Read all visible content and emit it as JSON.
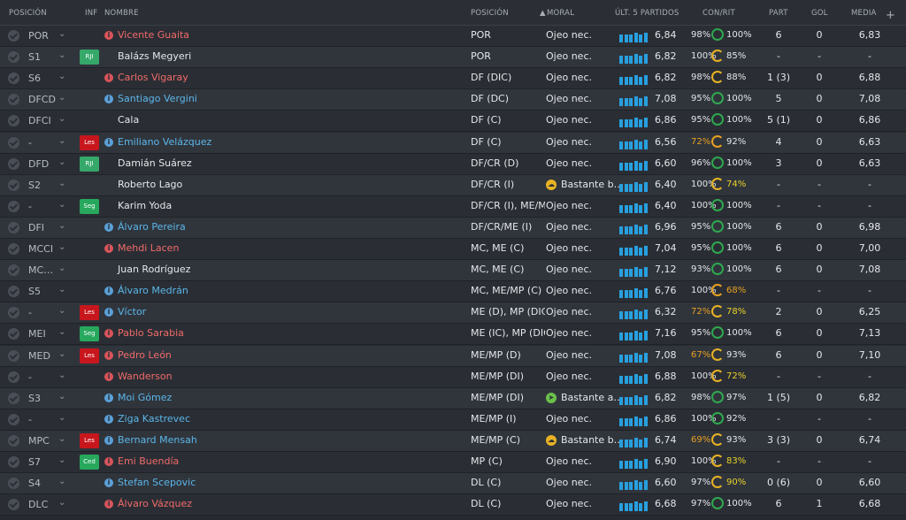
{
  "header": {
    "posicion": "POSICIÓN",
    "inf": "INF",
    "nombre": "NOMBRE",
    "posicion2": "POSICIÓN",
    "moral": "MORAL",
    "ult5": "ÚLT. 5 PARTIDOS",
    "conrit": "CON/RIT",
    "part": "PART",
    "gol": "GOL",
    "media": "MEDIA",
    "plus": "+"
  },
  "players": [
    {
      "pos": "POR",
      "badge": "",
      "info": "red",
      "name": "Vicente Guaita",
      "nameColor": "red",
      "cpos": "POR",
      "moral": "Ojeo nec.",
      "micon": "",
      "rating": "6,84",
      "con": "98%",
      "ring": "g",
      "rit": "100%",
      "part": "6",
      "gol": "0",
      "media": "6,83"
    },
    {
      "pos": "S1",
      "badge": "RJI",
      "info": "",
      "name": "Balázs Megyeri",
      "nameColor": "white",
      "cpos": "POR",
      "moral": "Ojeo nec.",
      "micon": "",
      "rating": "6,82",
      "con": "100%",
      "ring": "y",
      "rit": "85%",
      "part": "-",
      "gol": "-",
      "media": "-"
    },
    {
      "pos": "S6",
      "badge": "",
      "info": "red",
      "name": "Carlos Vigaray",
      "nameColor": "red",
      "cpos": "DF (DIC)",
      "moral": "Ojeo nec.",
      "micon": "",
      "rating": "6,82",
      "con": "98%",
      "ring": "y",
      "rit": "88%",
      "part": "1 (3)",
      "gol": "0",
      "media": "6,88"
    },
    {
      "pos": "DFCD",
      "badge": "",
      "info": "blue",
      "name": "Santiago Vergini",
      "nameColor": "blue",
      "cpos": "DF (DC)",
      "moral": "Ojeo nec.",
      "micon": "",
      "rating": "7,08",
      "con": "95%",
      "ring": "g",
      "rit": "100%",
      "part": "5",
      "gol": "0",
      "media": "7,08"
    },
    {
      "pos": "DFCI",
      "badge": "",
      "info": "",
      "name": "Cala",
      "nameColor": "white",
      "cpos": "DF (C)",
      "moral": "Ojeo nec.",
      "micon": "",
      "rating": "6,86",
      "con": "95%",
      "ring": "g",
      "rit": "100%",
      "part": "5 (1)",
      "gol": "0",
      "media": "6,86"
    },
    {
      "pos": "-",
      "badge": "Les",
      "info": "blue",
      "name": "Emiliano Velázquez",
      "nameColor": "blue",
      "cpos": "DF (C)",
      "moral": "Ojeo nec.",
      "micon": "",
      "rating": "6,56",
      "con": "72%",
      "conColor": "o",
      "ring": "o",
      "rit": "92%",
      "part": "4",
      "gol": "0",
      "media": "6,63"
    },
    {
      "pos": "DFD",
      "badge": "RJI",
      "info": "",
      "name": "Damián Suárez",
      "nameColor": "white",
      "cpos": "DF/CR (D)",
      "moral": "Ojeo nec.",
      "micon": "",
      "rating": "6,60",
      "con": "96%",
      "ring": "g",
      "rit": "100%",
      "part": "3",
      "gol": "0",
      "media": "6,63"
    },
    {
      "pos": "S2",
      "badge": "",
      "info": "",
      "name": "Roberto Lago",
      "nameColor": "white",
      "cpos": "DF/CR (I)",
      "moral": "Bastante b…",
      "micon": "y",
      "rating": "6,40",
      "con": "100%",
      "ring": "y",
      "rit": "74%",
      "ritColor": "y",
      "part": "-",
      "gol": "-",
      "media": "-"
    },
    {
      "pos": "-",
      "badge": "Seg",
      "info": "",
      "name": "Karim Yoda",
      "nameColor": "white",
      "cpos": "DF/CR (I), ME/M…",
      "moral": "Ojeo nec.",
      "micon": "",
      "rating": "6,40",
      "con": "100%",
      "ring": "g",
      "rit": "100%",
      "part": "-",
      "gol": "-",
      "media": "-"
    },
    {
      "pos": "DFI",
      "badge": "",
      "info": "blue",
      "name": "Álvaro Pereira",
      "nameColor": "blue",
      "cpos": "DF/CR/ME (I)",
      "moral": "Ojeo nec.",
      "micon": "",
      "rating": "6,96",
      "con": "95%",
      "ring": "g",
      "rit": "100%",
      "part": "6",
      "gol": "0",
      "media": "6,98"
    },
    {
      "pos": "MCCI",
      "badge": "",
      "info": "red",
      "name": "Mehdi Lacen",
      "nameColor": "red",
      "cpos": "MC, ME (C)",
      "moral": "Ojeo nec.",
      "micon": "",
      "rating": "7,04",
      "con": "95%",
      "ring": "g",
      "rit": "100%",
      "part": "6",
      "gol": "0",
      "media": "7,00"
    },
    {
      "pos": "MC…",
      "badge": "",
      "info": "",
      "name": "Juan Rodríguez",
      "nameColor": "white",
      "cpos": "MC, ME (C)",
      "moral": "Ojeo nec.",
      "micon": "",
      "rating": "7,12",
      "con": "93%",
      "ring": "g",
      "rit": "100%",
      "part": "6",
      "gol": "0",
      "media": "7,08"
    },
    {
      "pos": "S5",
      "badge": "",
      "info": "blue",
      "name": "Álvaro Medrán",
      "nameColor": "blue",
      "cpos": "MC, ME/MP (C)",
      "moral": "Ojeo nec.",
      "micon": "",
      "rating": "6,76",
      "con": "100%",
      "ring": "o",
      "rit": "68%",
      "ritColor": "o",
      "part": "-",
      "gol": "-",
      "media": "-"
    },
    {
      "pos": "-",
      "badge": "Les",
      "info": "blue",
      "name": "Víctor",
      "nameColor": "blue",
      "cpos": "ME (D), MP (DIC)",
      "moral": "Ojeo nec.",
      "micon": "",
      "rating": "6,32",
      "con": "72%",
      "conColor": "o",
      "ring": "y",
      "rit": "78%",
      "ritColor": "y",
      "part": "2",
      "gol": "0",
      "media": "6,25"
    },
    {
      "pos": "MEI",
      "badge": "Seg",
      "info": "red",
      "name": "Pablo Sarabia",
      "nameColor": "red",
      "cpos": "ME (IC), MP (DIC)",
      "moral": "Ojeo nec.",
      "micon": "",
      "rating": "7,16",
      "con": "95%",
      "ring": "g",
      "rit": "100%",
      "part": "6",
      "gol": "0",
      "media": "7,13"
    },
    {
      "pos": "MED",
      "badge": "Les",
      "info": "red",
      "name": "Pedro León",
      "nameColor": "red",
      "cpos": "ME/MP (D)",
      "moral": "Ojeo nec.",
      "micon": "",
      "rating": "7,08",
      "con": "67%",
      "conColor": "o",
      "ring": "y",
      "rit": "93%",
      "part": "6",
      "gol": "0",
      "media": "7,10"
    },
    {
      "pos": "-",
      "badge": "",
      "info": "red",
      "name": "Wanderson",
      "nameColor": "red",
      "cpos": "ME/MP (DI)",
      "moral": "Ojeo nec.",
      "micon": "",
      "rating": "6,88",
      "con": "100%",
      "ring": "y",
      "rit": "72%",
      "ritColor": "y",
      "part": "-",
      "gol": "-",
      "media": "-"
    },
    {
      "pos": "S3",
      "badge": "",
      "info": "blue",
      "name": "Moi Gómez",
      "nameColor": "blue",
      "cpos": "ME/MP (DI)",
      "moral": "Bastante a…",
      "micon": "g",
      "rating": "6,82",
      "con": "98%",
      "ring": "g",
      "rit": "97%",
      "part": "1 (5)",
      "gol": "0",
      "media": "6,82"
    },
    {
      "pos": "-",
      "badge": "",
      "info": "blue",
      "name": "Ziga Kastrevec",
      "nameColor": "blue",
      "cpos": "ME/MP (I)",
      "moral": "Ojeo nec.",
      "micon": "",
      "rating": "6,86",
      "con": "100%",
      "ring": "g",
      "rit": "92%",
      "part": "-",
      "gol": "-",
      "media": "-"
    },
    {
      "pos": "MPC",
      "badge": "Les",
      "info": "blue",
      "name": "Bernard Mensah",
      "nameColor": "blue",
      "cpos": "ME/MP (C)",
      "moral": "Bastante b…",
      "micon": "y",
      "rating": "6,74",
      "con": "69%",
      "conColor": "o",
      "ring": "y",
      "rit": "93%",
      "part": "3 (3)",
      "gol": "0",
      "media": "6,74"
    },
    {
      "pos": "S7",
      "badge": "Ced",
      "info": "red",
      "name": "Emi Buendía",
      "nameColor": "red",
      "cpos": "MP (C)",
      "moral": "Ojeo nec.",
      "micon": "",
      "rating": "6,90",
      "con": "100%",
      "ring": "y",
      "rit": "83%",
      "ritColor": "y",
      "part": "-",
      "gol": "-",
      "media": "-"
    },
    {
      "pos": "S4",
      "badge": "",
      "info": "blue",
      "name": "Stefan Scepovic",
      "nameColor": "blue",
      "cpos": "DL (C)",
      "moral": "Ojeo nec.",
      "micon": "",
      "rating": "6,60",
      "con": "97%",
      "ring": "y",
      "rit": "90%",
      "ritColor": "y",
      "part": "0 (6)",
      "gol": "0",
      "media": "6,60"
    },
    {
      "pos": "DLC",
      "badge": "",
      "info": "red",
      "name": "Álvaro Vázquez",
      "nameColor": "red",
      "cpos": "DL (C)",
      "moral": "Ojeo nec.",
      "micon": "",
      "rating": "6,68",
      "con": "97%",
      "ring": "g",
      "rit": "100%",
      "part": "6",
      "gol": "1",
      "media": "6,68"
    }
  ]
}
